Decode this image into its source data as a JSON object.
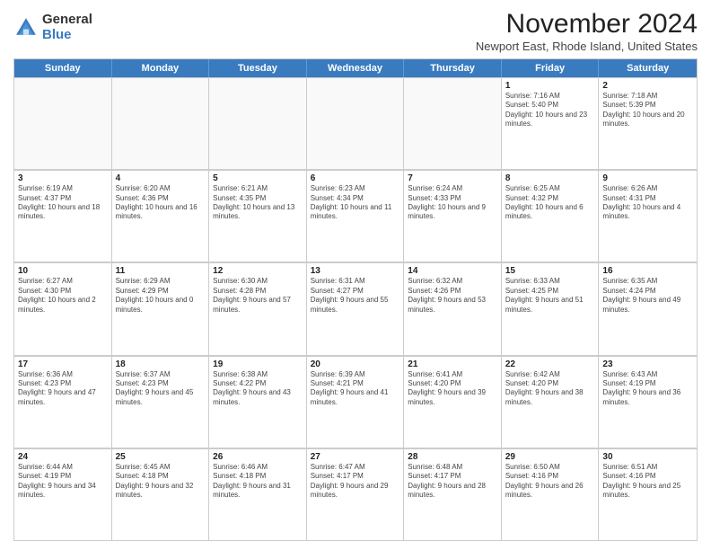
{
  "logo": {
    "general": "General",
    "blue": "Blue"
  },
  "title": "November 2024",
  "location": "Newport East, Rhode Island, United States",
  "weekdays": [
    "Sunday",
    "Monday",
    "Tuesday",
    "Wednesday",
    "Thursday",
    "Friday",
    "Saturday"
  ],
  "rows": [
    [
      {
        "day": "",
        "info": ""
      },
      {
        "day": "",
        "info": ""
      },
      {
        "day": "",
        "info": ""
      },
      {
        "day": "",
        "info": ""
      },
      {
        "day": "",
        "info": ""
      },
      {
        "day": "1",
        "info": "Sunrise: 7:16 AM\nSunset: 5:40 PM\nDaylight: 10 hours and 23 minutes."
      },
      {
        "day": "2",
        "info": "Sunrise: 7:18 AM\nSunset: 5:39 PM\nDaylight: 10 hours and 20 minutes."
      }
    ],
    [
      {
        "day": "3",
        "info": "Sunrise: 6:19 AM\nSunset: 4:37 PM\nDaylight: 10 hours and 18 minutes."
      },
      {
        "day": "4",
        "info": "Sunrise: 6:20 AM\nSunset: 4:36 PM\nDaylight: 10 hours and 16 minutes."
      },
      {
        "day": "5",
        "info": "Sunrise: 6:21 AM\nSunset: 4:35 PM\nDaylight: 10 hours and 13 minutes."
      },
      {
        "day": "6",
        "info": "Sunrise: 6:23 AM\nSunset: 4:34 PM\nDaylight: 10 hours and 11 minutes."
      },
      {
        "day": "7",
        "info": "Sunrise: 6:24 AM\nSunset: 4:33 PM\nDaylight: 10 hours and 9 minutes."
      },
      {
        "day": "8",
        "info": "Sunrise: 6:25 AM\nSunset: 4:32 PM\nDaylight: 10 hours and 6 minutes."
      },
      {
        "day": "9",
        "info": "Sunrise: 6:26 AM\nSunset: 4:31 PM\nDaylight: 10 hours and 4 minutes."
      }
    ],
    [
      {
        "day": "10",
        "info": "Sunrise: 6:27 AM\nSunset: 4:30 PM\nDaylight: 10 hours and 2 minutes."
      },
      {
        "day": "11",
        "info": "Sunrise: 6:29 AM\nSunset: 4:29 PM\nDaylight: 10 hours and 0 minutes."
      },
      {
        "day": "12",
        "info": "Sunrise: 6:30 AM\nSunset: 4:28 PM\nDaylight: 9 hours and 57 minutes."
      },
      {
        "day": "13",
        "info": "Sunrise: 6:31 AM\nSunset: 4:27 PM\nDaylight: 9 hours and 55 minutes."
      },
      {
        "day": "14",
        "info": "Sunrise: 6:32 AM\nSunset: 4:26 PM\nDaylight: 9 hours and 53 minutes."
      },
      {
        "day": "15",
        "info": "Sunrise: 6:33 AM\nSunset: 4:25 PM\nDaylight: 9 hours and 51 minutes."
      },
      {
        "day": "16",
        "info": "Sunrise: 6:35 AM\nSunset: 4:24 PM\nDaylight: 9 hours and 49 minutes."
      }
    ],
    [
      {
        "day": "17",
        "info": "Sunrise: 6:36 AM\nSunset: 4:23 PM\nDaylight: 9 hours and 47 minutes."
      },
      {
        "day": "18",
        "info": "Sunrise: 6:37 AM\nSunset: 4:23 PM\nDaylight: 9 hours and 45 minutes."
      },
      {
        "day": "19",
        "info": "Sunrise: 6:38 AM\nSunset: 4:22 PM\nDaylight: 9 hours and 43 minutes."
      },
      {
        "day": "20",
        "info": "Sunrise: 6:39 AM\nSunset: 4:21 PM\nDaylight: 9 hours and 41 minutes."
      },
      {
        "day": "21",
        "info": "Sunrise: 6:41 AM\nSunset: 4:20 PM\nDaylight: 9 hours and 39 minutes."
      },
      {
        "day": "22",
        "info": "Sunrise: 6:42 AM\nSunset: 4:20 PM\nDaylight: 9 hours and 38 minutes."
      },
      {
        "day": "23",
        "info": "Sunrise: 6:43 AM\nSunset: 4:19 PM\nDaylight: 9 hours and 36 minutes."
      }
    ],
    [
      {
        "day": "24",
        "info": "Sunrise: 6:44 AM\nSunset: 4:19 PM\nDaylight: 9 hours and 34 minutes."
      },
      {
        "day": "25",
        "info": "Sunrise: 6:45 AM\nSunset: 4:18 PM\nDaylight: 9 hours and 32 minutes."
      },
      {
        "day": "26",
        "info": "Sunrise: 6:46 AM\nSunset: 4:18 PM\nDaylight: 9 hours and 31 minutes."
      },
      {
        "day": "27",
        "info": "Sunrise: 6:47 AM\nSunset: 4:17 PM\nDaylight: 9 hours and 29 minutes."
      },
      {
        "day": "28",
        "info": "Sunrise: 6:48 AM\nSunset: 4:17 PM\nDaylight: 9 hours and 28 minutes."
      },
      {
        "day": "29",
        "info": "Sunrise: 6:50 AM\nSunset: 4:16 PM\nDaylight: 9 hours and 26 minutes."
      },
      {
        "day": "30",
        "info": "Sunrise: 6:51 AM\nSunset: 4:16 PM\nDaylight: 9 hours and 25 minutes."
      }
    ]
  ]
}
